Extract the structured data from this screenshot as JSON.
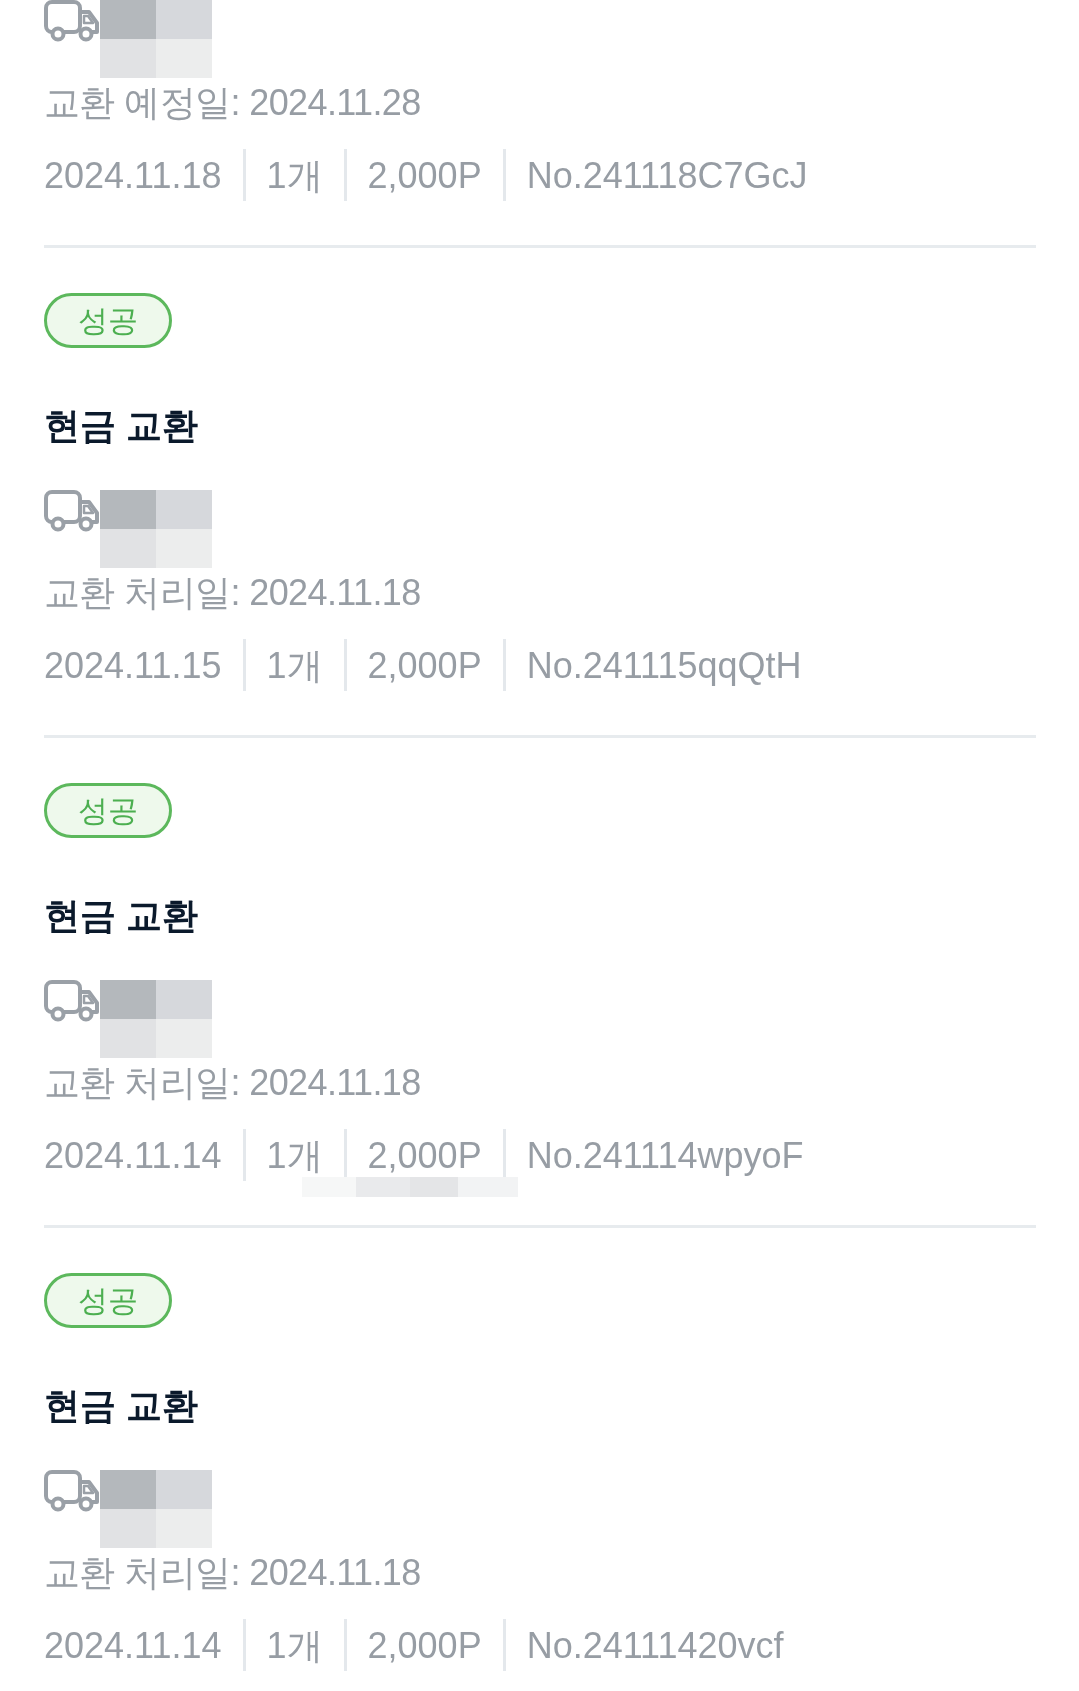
{
  "records": [
    {
      "redacted": true,
      "date_label": "교환 예정일: 2024.11.28",
      "order_date": "2024.11.18",
      "quantity": "1개",
      "points": "2,000P",
      "order_no": "No.241118C7GcJ",
      "meta_redacted": false
    },
    {
      "status": {
        "label": "성공",
        "kind": "success"
      },
      "title": "현금 교환",
      "redacted": true,
      "date_label": "교환 처리일: 2024.11.18",
      "order_date": "2024.11.15",
      "quantity": "1개",
      "points": "2,000P",
      "order_no": "No.241115qqQtH",
      "meta_redacted": false
    },
    {
      "status": {
        "label": "성공",
        "kind": "success"
      },
      "title": "현금 교환",
      "redacted": true,
      "date_label": "교환 처리일: 2024.11.18",
      "order_date": "2024.11.14",
      "quantity": "1개",
      "points": "2,000P",
      "order_no": "No.241114wpyoF",
      "meta_redacted": true
    },
    {
      "status": {
        "label": "성공",
        "kind": "success"
      },
      "title": "현금 교환",
      "redacted": true,
      "date_label": "교환 처리일: 2024.11.18",
      "order_date": "2024.11.14",
      "quantity": "1개",
      "points": "2,000P",
      "order_no": "No.24111420vcf",
      "meta_redacted": false
    }
  ]
}
